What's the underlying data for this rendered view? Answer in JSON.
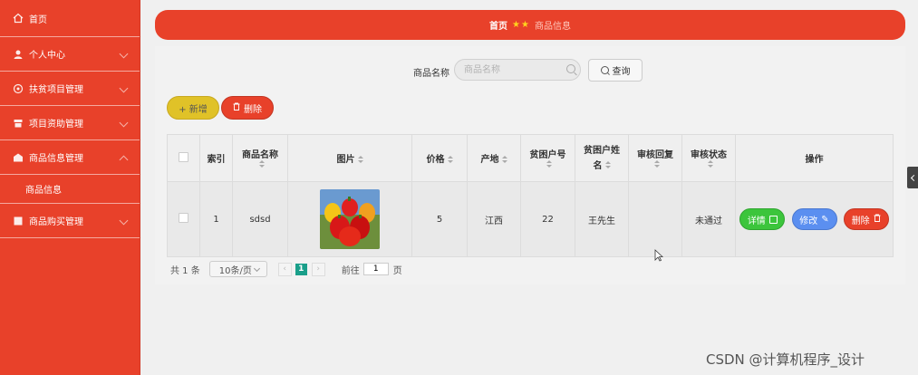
{
  "sidebar": {
    "items": [
      {
        "label": "首页",
        "icon": "home-icon",
        "has_chevron": false
      },
      {
        "label": "个人中心",
        "icon": "user-icon",
        "has_chevron": true
      },
      {
        "label": "扶贫项目管理",
        "icon": "project-icon",
        "has_chevron": true
      },
      {
        "label": "项目资助管理",
        "icon": "funding-icon",
        "has_chevron": true
      },
      {
        "label": "商品信息管理",
        "icon": "goods-icon",
        "has_chevron": true,
        "expanded": true
      },
      {
        "label": "商品购买管理",
        "icon": "cart-icon",
        "has_chevron": true
      }
    ],
    "sub_item": "商品信息",
    "color": "#e8412a"
  },
  "breadcrumb": {
    "home": "首页",
    "separator": "★★",
    "current": "商品信息"
  },
  "search": {
    "label": "商品名称",
    "placeholder": "商品名称",
    "button": "查询"
  },
  "actions": {
    "add": "+ 新增",
    "delete": "删除"
  },
  "table": {
    "headers": [
      "",
      "索引",
      "商品名称",
      "图片",
      "价格",
      "产地",
      "贫困户号",
      "贫困户姓名",
      "审核回复",
      "审核状态",
      "操作"
    ],
    "rows": [
      {
        "index": "1",
        "name": "sdsd",
        "price": "5",
        "origin": "江西",
        "household_no": "22",
        "household_name": "王先生",
        "review_reply": "",
        "review_status": "未通过"
      }
    ],
    "ops": {
      "detail": "详情",
      "edit": "修改",
      "delete": "删除"
    }
  },
  "pagination": {
    "total": "共 1 条",
    "page_size": "10条/页",
    "current": "1",
    "goto_label": "前往",
    "goto_value": "1",
    "goto_suffix": "页"
  },
  "watermark": "CSDN @计算机程序_设计",
  "colors": {
    "accent": "#e8412a",
    "yellow": "#e0c228",
    "green": "#3cc53c",
    "blue": "#5b8ff0",
    "teal": "#1a9f8a"
  }
}
